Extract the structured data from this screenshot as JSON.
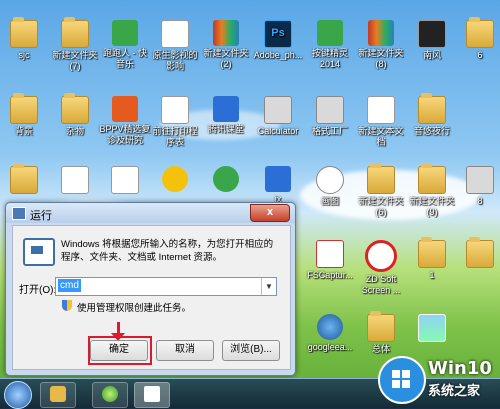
{
  "desktop": {
    "icons": [
      {
        "label": "sjc",
        "icon": "folder-icon"
      },
      {
        "label": "新建文件夹\n(7)",
        "icon": "folder-icon"
      },
      {
        "label": "跑跑人 - 快\n音乐",
        "icon": "music-app-icon"
      },
      {
        "label": "原生影视的\n影响",
        "icon": "document-icon"
      },
      {
        "label": "新建文件夹\n(2)",
        "icon": "archive-icon"
      },
      {
        "label": "Adobe_ph...",
        "icon": "photoshop-icon"
      },
      {
        "label": "按键精灵\n2014",
        "icon": "app-icon"
      },
      {
        "label": "新建文件夹\n(8)",
        "icon": "archive-icon"
      },
      {
        "label": "南风",
        "icon": "media-icon"
      },
      {
        "label": "6",
        "icon": "folder-icon"
      },
      {
        "label": "背景",
        "icon": "folder-icon"
      },
      {
        "label": "杂物",
        "icon": "folder-icon"
      },
      {
        "label": "BPPV精选复\n诊及研究",
        "icon": "presentation-icon"
      },
      {
        "label": "前往打印程\n序表",
        "icon": "document-icon"
      },
      {
        "label": "腾讯课堂",
        "icon": "app-icon"
      },
      {
        "label": "Calculator",
        "icon": "calculator-icon"
      },
      {
        "label": "格式工厂",
        "icon": "app-icon"
      },
      {
        "label": "新建文本文\n档",
        "icon": "text-file-icon"
      },
      {
        "label": "音悠夜行",
        "icon": "folder-icon"
      },
      {
        "label": "",
        "icon": "folder-icon"
      },
      {
        "label": "",
        "icon": "folder-icon"
      },
      {
        "label": "",
        "icon": "document-icon"
      },
      {
        "label": "",
        "icon": "text-file-icon"
      },
      {
        "label": "",
        "icon": "app-icon"
      },
      {
        "label": "",
        "icon": "wechat-icon"
      },
      {
        "label": "",
        "icon": "app-icon"
      },
      {
        "label": "jx",
        "icon": "folder-icon"
      },
      {
        "label": "画图",
        "icon": "paint-icon"
      },
      {
        "label": "新建文件夹\n(6)",
        "icon": "folder-icon"
      },
      {
        "label": "新建文件夹\n(9)",
        "icon": "folder-icon"
      },
      {
        "label": "8",
        "icon": "window-icon"
      },
      {
        "label": "FSCaptur...",
        "icon": "app-icon"
      },
      {
        "label": "ZD Soft\nScreen ...",
        "icon": "record-icon"
      },
      {
        "label": "1",
        "icon": "folder-icon"
      },
      {
        "label": "",
        "icon": "folder-icon"
      },
      {
        "label": "googleea...",
        "icon": "globe-icon"
      },
      {
        "label": "总体",
        "icon": "folder-icon"
      },
      {
        "label": "",
        "icon": "image-icon"
      }
    ]
  },
  "run_dialog": {
    "title": "运行",
    "close_label": "x",
    "description": "Windows 将根据您所输入的名称，为您打开相应的程序、文件夹、文档或 Internet 资源。",
    "open_label": "打开(O):",
    "input_value": "cmd",
    "admin_note": "使用管理权限创建此任务。",
    "ok_label": "确定",
    "cancel_label": "取消",
    "browse_label": "浏览(B)..."
  },
  "taskbar": {
    "items": [
      "start-button",
      "explorer-button",
      "browser-button",
      "run-window-button"
    ]
  },
  "watermark": {
    "title": "Win10",
    "subtitle": "系统之家"
  }
}
